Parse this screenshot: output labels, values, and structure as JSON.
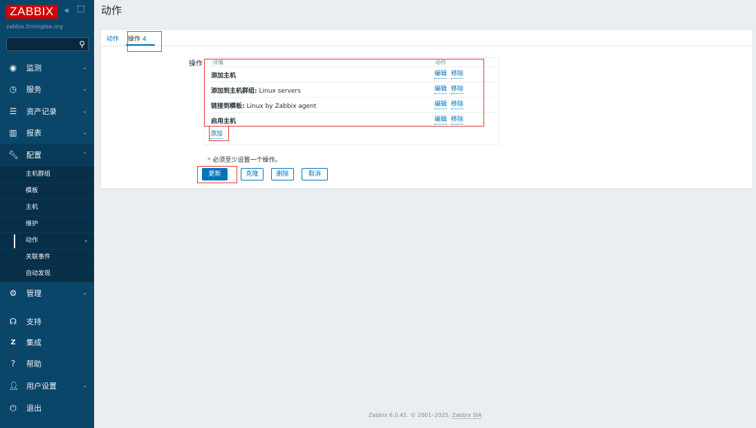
{
  "sidebar": {
    "logo": "ZABBIX",
    "server_name": "zabbix.timinglee.org",
    "menu": [
      {
        "label": "监测",
        "icon": "eye-icon"
      },
      {
        "label": "服务",
        "icon": "clock-icon"
      },
      {
        "label": "资产记录",
        "icon": "list-icon"
      },
      {
        "label": "报表",
        "icon": "chart-icon"
      },
      {
        "label": "配置",
        "icon": "wrench-icon"
      },
      {
        "label": "管理",
        "icon": "gear-icon"
      },
      {
        "label": "支持",
        "icon": "headset-icon"
      },
      {
        "label": "集成",
        "icon": "z-icon"
      },
      {
        "label": "帮助",
        "icon": "question-icon"
      },
      {
        "label": "用户设置",
        "icon": "user-icon"
      },
      {
        "label": "退出",
        "icon": "power-icon"
      }
    ],
    "config_submenu": [
      "主机群组",
      "模板",
      "主机",
      "维护",
      "动作",
      "关联事件",
      "自动发现"
    ]
  },
  "header": {
    "title": "动作"
  },
  "tabs": [
    {
      "label": "动作"
    },
    {
      "label": "操作",
      "count": "4"
    }
  ],
  "operations": {
    "field_label": "操作",
    "col_details": "详情",
    "col_actions": "动作",
    "rows": [
      {
        "bold": "添加主机",
        "rest": ""
      },
      {
        "bold": "添加到主机群组:",
        "rest": " Linux servers"
      },
      {
        "bold": "链接到模板:",
        "rest": " Linux by Zabbix agent"
      },
      {
        "bold": "启用主机",
        "rest": ""
      }
    ],
    "edit_label": "编辑",
    "remove_label": "移除",
    "add_label": "添加"
  },
  "required_note": "必须至少设置一个操作。",
  "buttons": {
    "update": "更新",
    "clone": "克隆",
    "delete": "删除",
    "cancel": "取消"
  },
  "footer": {
    "text": "Zabbix 6.0.41. © 2001–2025, ",
    "company": "Zabbix SIA"
  },
  "colors": {
    "sidebar": "#0a466a",
    "accent": "#0275b8",
    "highlight": "#e53935",
    "logo": "#d40000"
  }
}
